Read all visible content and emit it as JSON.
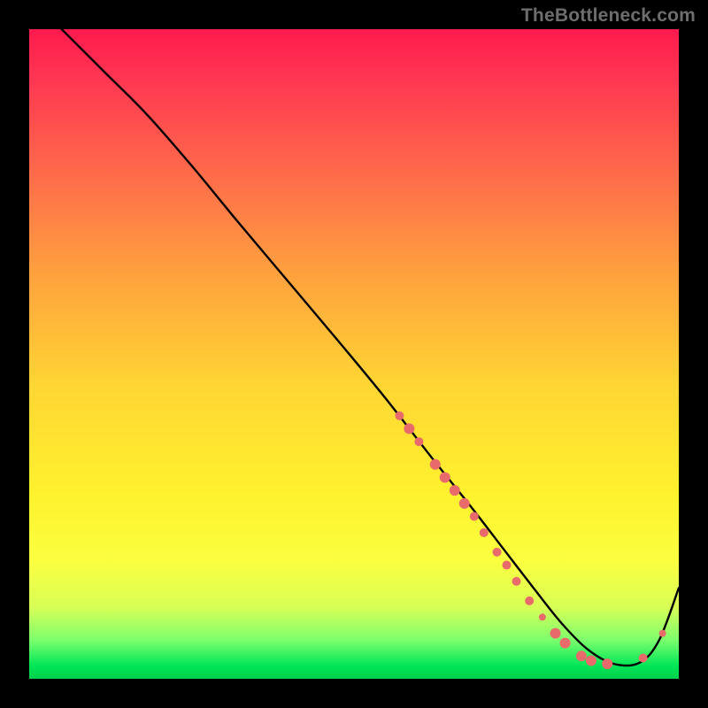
{
  "watermark": "TheBottleneck.com",
  "chart_data": {
    "type": "line",
    "title": "",
    "xlabel": "",
    "ylabel": "",
    "xlim": [
      0,
      100
    ],
    "ylim": [
      0,
      100
    ],
    "curve": {
      "name": "bottleneck-curve",
      "x": [
        5,
        8,
        12,
        18,
        25,
        32,
        40,
        48,
        55,
        62,
        68,
        73,
        78,
        82,
        86,
        90,
        94,
        97,
        100
      ],
      "y": [
        100,
        97,
        93,
        87,
        79,
        70.5,
        61,
        51.5,
        43,
        34,
        26.5,
        20,
        13.5,
        8.5,
        4.5,
        2.3,
        2.5,
        6,
        14
      ]
    },
    "markers": {
      "name": "highlighted-points",
      "color": "#e86a6a",
      "points": [
        {
          "x": 57,
          "y": 40.5,
          "r": 5
        },
        {
          "x": 58.5,
          "y": 38.5,
          "r": 6
        },
        {
          "x": 60,
          "y": 36.5,
          "r": 5
        },
        {
          "x": 62.5,
          "y": 33,
          "r": 6
        },
        {
          "x": 64,
          "y": 31,
          "r": 6
        },
        {
          "x": 65.5,
          "y": 29,
          "r": 6
        },
        {
          "x": 67,
          "y": 27,
          "r": 6
        },
        {
          "x": 68.5,
          "y": 25,
          "r": 5
        },
        {
          "x": 70,
          "y": 22.5,
          "r": 5
        },
        {
          "x": 72,
          "y": 19.5,
          "r": 5
        },
        {
          "x": 73.5,
          "y": 17.5,
          "r": 5
        },
        {
          "x": 75,
          "y": 15,
          "r": 5
        },
        {
          "x": 77,
          "y": 12,
          "r": 5
        },
        {
          "x": 79,
          "y": 9.5,
          "r": 4
        },
        {
          "x": 81,
          "y": 7,
          "r": 6
        },
        {
          "x": 82.5,
          "y": 5.5,
          "r": 6
        },
        {
          "x": 85,
          "y": 3.5,
          "r": 6
        },
        {
          "x": 86.5,
          "y": 2.8,
          "r": 6
        },
        {
          "x": 89,
          "y": 2.3,
          "r": 6
        },
        {
          "x": 94.5,
          "y": 3.2,
          "r": 5
        },
        {
          "x": 97.5,
          "y": 7,
          "r": 4
        }
      ]
    },
    "background_gradient": {
      "top": "#ff1a4d",
      "mid_upper": "#ffa23e",
      "mid": "#fff22e",
      "mid_lower": "#d8ff56",
      "bottom": "#00d04c"
    }
  }
}
